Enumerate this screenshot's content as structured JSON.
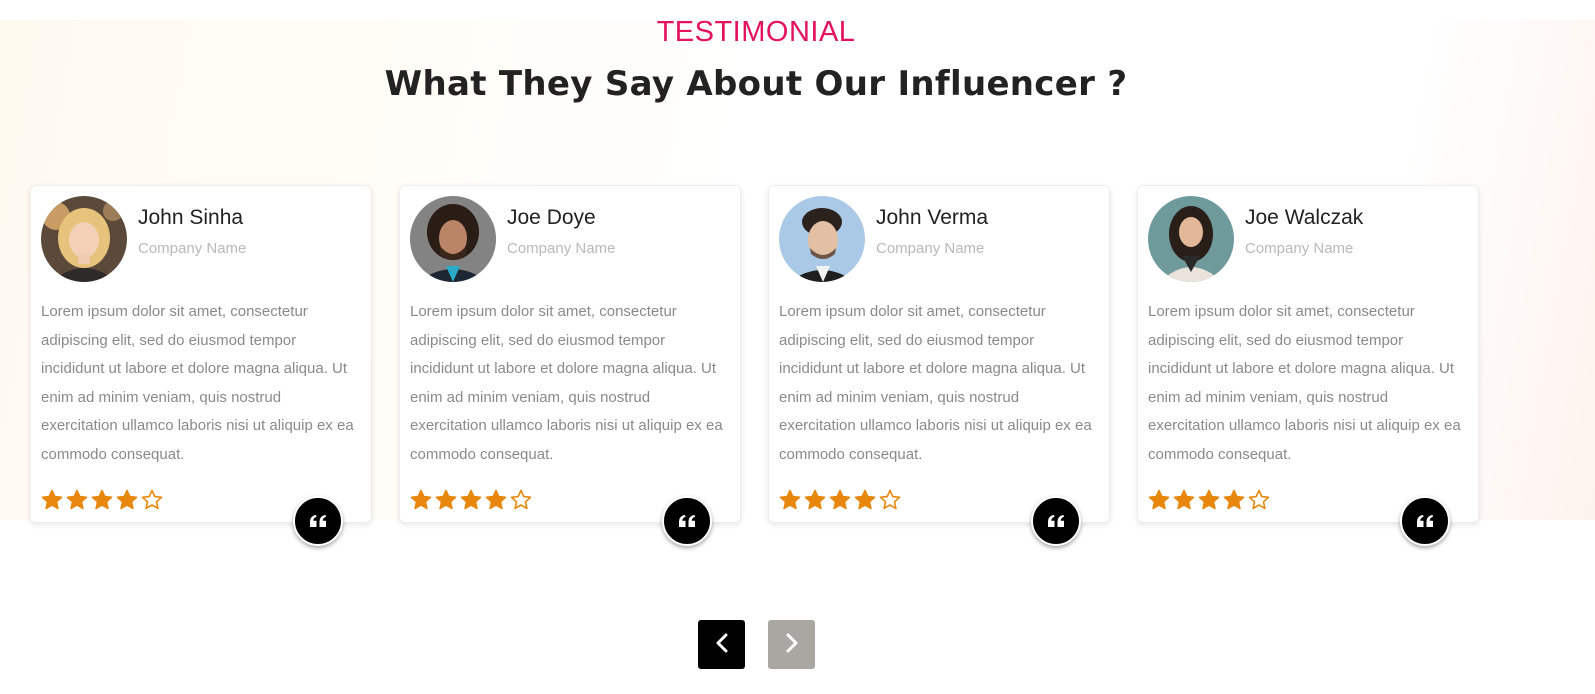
{
  "section": {
    "kicker": "TESTIMONIAL",
    "title": "What They Say About Our Influencer ?"
  },
  "colors": {
    "accent": "#e3135e",
    "star": "#e8870d",
    "prev_button": "#000000",
    "next_button": "#a8a7a1"
  },
  "rating": {
    "value": 4,
    "max": 5
  },
  "testimonials": [
    {
      "name": "John Sinha",
      "company": "Company Name",
      "text": "Lorem ipsum dolor sit amet, consectetur adipiscing elit, sed do eiusmod tempor incididunt ut labore et dolore magna aliqua. Ut enim ad minim veniam, quis nostrud exercitation ullamco laboris nisi ut aliquip ex ea commodo consequat.",
      "rating": 4,
      "avatar": "woman-blonde-avatar"
    },
    {
      "name": "Joe Doye",
      "company": "Company Name",
      "text": "Lorem ipsum dolor sit amet, consectetur adipiscing elit, sed do eiusmod tempor incididunt ut labore et dolore magna aliqua. Ut enim ad minim veniam, quis nostrud exercitation ullamco laboris nisi ut aliquip ex ea commodo consequat.",
      "rating": 4,
      "avatar": "man-curly-hair-avatar"
    },
    {
      "name": "John Verma",
      "company": "Company Name",
      "text": "Lorem ipsum dolor sit amet, consectetur adipiscing elit, sed do eiusmod tempor incididunt ut labore et dolore magna aliqua. Ut enim ad minim veniam, quis nostrud exercitation ullamco laboris nisi ut aliquip ex ea commodo consequat.",
      "rating": 4,
      "avatar": "man-styled-hair-avatar"
    },
    {
      "name": "Joe Walczak",
      "company": "Company Name",
      "text": "Lorem ipsum dolor sit amet, consectetur adipiscing elit, sed do eiusmod tempor incididunt ut labore et dolore magna aliqua. Ut enim ad minim veniam, quis nostrud exercitation ullamco laboris nisi ut aliquip ex ea commodo consequat.",
      "rating": 4,
      "avatar": "woman-dark-hair-avatar"
    }
  ],
  "icons": {
    "quote": "quote-icon",
    "star_filled": "star-filled-icon",
    "star_empty": "star-empty-icon",
    "prev": "chevron-left-icon",
    "next": "chevron-right-icon"
  }
}
